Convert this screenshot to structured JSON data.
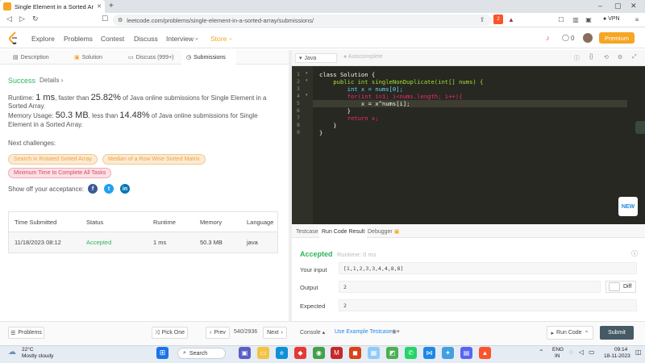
{
  "browser": {
    "tab_title": "Single Element in a Sorted Array",
    "new_tab": "+",
    "url": "leetcode.com/problems/single-element-in-a-sorted-array/submissions/",
    "vpn": "VPN",
    "shield_count": "2",
    "minimize": "–",
    "maximize": "▢",
    "close": "✕"
  },
  "header": {
    "nav": [
      "Explore",
      "Problems",
      "Contest",
      "Discuss",
      "Interview",
      "Store"
    ],
    "notifications": "0",
    "premium": "Premium",
    "accent": "#f5a623"
  },
  "left_tabs": [
    "Description",
    "Solution",
    "Discuss (999+)",
    "Submissions"
  ],
  "result": {
    "status": "Success",
    "details": "Details",
    "runtime_prefix": "Runtime:",
    "runtime_value": "1 ms",
    "runtime_mid": ", faster than",
    "runtime_pct": "25.82%",
    "runtime_suffix": "of Java online submissions for Single Element in a Sorted Array.",
    "memory_prefix": "Memory Usage:",
    "memory_value": "50.3 MB",
    "memory_mid": ", less than",
    "memory_pct": "14.48%",
    "memory_suffix": "of Java online submissions for Single Element in a Sorted Array.",
    "next_challenges": "Next challenges:",
    "challenges": [
      "Search in Rotated Sorted Array",
      "Median of a Row Wise Sorted Matrix",
      "Minimum Time to Complete All Tasks"
    ],
    "show_off": "Show off your acceptance:",
    "success_color": "#2db55d"
  },
  "submissions": {
    "headers": [
      "Time Submitted",
      "Status",
      "Runtime",
      "Memory",
      "Language"
    ],
    "rows": [
      {
        "time": "11/18/2023 08:12",
        "status": "Accepted",
        "runtime": "1 ms",
        "memory": "50.3 MB",
        "language": "java"
      }
    ]
  },
  "editor": {
    "language": "Java",
    "autocomplete": "Autocomplete",
    "line_numbers": [
      "1",
      "2",
      "3",
      "4",
      "5",
      "6",
      "7",
      "8",
      "9"
    ],
    "lines": [
      "class Solution {",
      "    public int singleNonDuplicate(int[] nums) {",
      "        int x = nums[0];",
      "        for(int i=1; i<nums.length; i++){",
      "            x = x^nums[i];",
      "        }",
      "        return x;",
      "    }",
      "}"
    ],
    "new_badge": "NEW"
  },
  "result_panel": {
    "tabs": [
      "Testcase",
      "Run Code Result",
      "Debugger"
    ],
    "status": "Accepted",
    "runtime": "Runtime: 0 ms",
    "your_input_label": "Your input",
    "your_input": "[1,1,2,3,3,4,4,8,8]",
    "output_label": "Output",
    "output": "2",
    "expected_label": "Expected",
    "expected": "2",
    "diff": "Diff"
  },
  "bottom": {
    "problems": "Problems",
    "pick_one": "Pick One",
    "prev": "Prev",
    "page": "540/2936",
    "next": "Next",
    "console": "Console",
    "use_example": "Use Example Testcases",
    "run_code": "Run Code",
    "submit": "Submit"
  },
  "taskbar": {
    "temp": "22°C",
    "weather": "Mostly cloudy",
    "search": "Search",
    "lang_line1": "ENG",
    "lang_line2": "IN",
    "time": "09:14",
    "date": "18-11-2023"
  }
}
